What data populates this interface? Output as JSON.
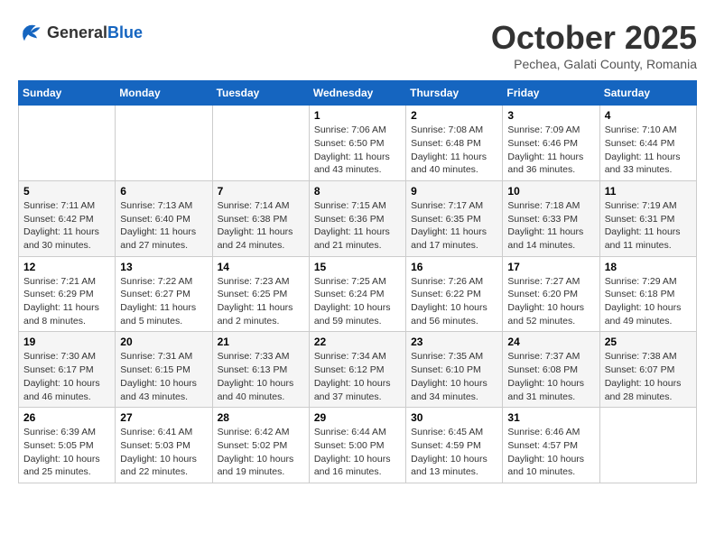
{
  "header": {
    "logo_general": "General",
    "logo_blue": "Blue",
    "month_title": "October 2025",
    "subtitle": "Pechea, Galati County, Romania"
  },
  "weekdays": [
    "Sunday",
    "Monday",
    "Tuesday",
    "Wednesday",
    "Thursday",
    "Friday",
    "Saturday"
  ],
  "weeks": [
    [
      {
        "day": "",
        "info": ""
      },
      {
        "day": "",
        "info": ""
      },
      {
        "day": "",
        "info": ""
      },
      {
        "day": "1",
        "info": "Sunrise: 7:06 AM\nSunset: 6:50 PM\nDaylight: 11 hours and 43 minutes."
      },
      {
        "day": "2",
        "info": "Sunrise: 7:08 AM\nSunset: 6:48 PM\nDaylight: 11 hours and 40 minutes."
      },
      {
        "day": "3",
        "info": "Sunrise: 7:09 AM\nSunset: 6:46 PM\nDaylight: 11 hours and 36 minutes."
      },
      {
        "day": "4",
        "info": "Sunrise: 7:10 AM\nSunset: 6:44 PM\nDaylight: 11 hours and 33 minutes."
      }
    ],
    [
      {
        "day": "5",
        "info": "Sunrise: 7:11 AM\nSunset: 6:42 PM\nDaylight: 11 hours and 30 minutes."
      },
      {
        "day": "6",
        "info": "Sunrise: 7:13 AM\nSunset: 6:40 PM\nDaylight: 11 hours and 27 minutes."
      },
      {
        "day": "7",
        "info": "Sunrise: 7:14 AM\nSunset: 6:38 PM\nDaylight: 11 hours and 24 minutes."
      },
      {
        "day": "8",
        "info": "Sunrise: 7:15 AM\nSunset: 6:36 PM\nDaylight: 11 hours and 21 minutes."
      },
      {
        "day": "9",
        "info": "Sunrise: 7:17 AM\nSunset: 6:35 PM\nDaylight: 11 hours and 17 minutes."
      },
      {
        "day": "10",
        "info": "Sunrise: 7:18 AM\nSunset: 6:33 PM\nDaylight: 11 hours and 14 minutes."
      },
      {
        "day": "11",
        "info": "Sunrise: 7:19 AM\nSunset: 6:31 PM\nDaylight: 11 hours and 11 minutes."
      }
    ],
    [
      {
        "day": "12",
        "info": "Sunrise: 7:21 AM\nSunset: 6:29 PM\nDaylight: 11 hours and 8 minutes."
      },
      {
        "day": "13",
        "info": "Sunrise: 7:22 AM\nSunset: 6:27 PM\nDaylight: 11 hours and 5 minutes."
      },
      {
        "day": "14",
        "info": "Sunrise: 7:23 AM\nSunset: 6:25 PM\nDaylight: 11 hours and 2 minutes."
      },
      {
        "day": "15",
        "info": "Sunrise: 7:25 AM\nSunset: 6:24 PM\nDaylight: 10 hours and 59 minutes."
      },
      {
        "day": "16",
        "info": "Sunrise: 7:26 AM\nSunset: 6:22 PM\nDaylight: 10 hours and 56 minutes."
      },
      {
        "day": "17",
        "info": "Sunrise: 7:27 AM\nSunset: 6:20 PM\nDaylight: 10 hours and 52 minutes."
      },
      {
        "day": "18",
        "info": "Sunrise: 7:29 AM\nSunset: 6:18 PM\nDaylight: 10 hours and 49 minutes."
      }
    ],
    [
      {
        "day": "19",
        "info": "Sunrise: 7:30 AM\nSunset: 6:17 PM\nDaylight: 10 hours and 46 minutes."
      },
      {
        "day": "20",
        "info": "Sunrise: 7:31 AM\nSunset: 6:15 PM\nDaylight: 10 hours and 43 minutes."
      },
      {
        "day": "21",
        "info": "Sunrise: 7:33 AM\nSunset: 6:13 PM\nDaylight: 10 hours and 40 minutes."
      },
      {
        "day": "22",
        "info": "Sunrise: 7:34 AM\nSunset: 6:12 PM\nDaylight: 10 hours and 37 minutes."
      },
      {
        "day": "23",
        "info": "Sunrise: 7:35 AM\nSunset: 6:10 PM\nDaylight: 10 hours and 34 minutes."
      },
      {
        "day": "24",
        "info": "Sunrise: 7:37 AM\nSunset: 6:08 PM\nDaylight: 10 hours and 31 minutes."
      },
      {
        "day": "25",
        "info": "Sunrise: 7:38 AM\nSunset: 6:07 PM\nDaylight: 10 hours and 28 minutes."
      }
    ],
    [
      {
        "day": "26",
        "info": "Sunrise: 6:39 AM\nSunset: 5:05 PM\nDaylight: 10 hours and 25 minutes."
      },
      {
        "day": "27",
        "info": "Sunrise: 6:41 AM\nSunset: 5:03 PM\nDaylight: 10 hours and 22 minutes."
      },
      {
        "day": "28",
        "info": "Sunrise: 6:42 AM\nSunset: 5:02 PM\nDaylight: 10 hours and 19 minutes."
      },
      {
        "day": "29",
        "info": "Sunrise: 6:44 AM\nSunset: 5:00 PM\nDaylight: 10 hours and 16 minutes."
      },
      {
        "day": "30",
        "info": "Sunrise: 6:45 AM\nSunset: 4:59 PM\nDaylight: 10 hours and 13 minutes."
      },
      {
        "day": "31",
        "info": "Sunrise: 6:46 AM\nSunset: 4:57 PM\nDaylight: 10 hours and 10 minutes."
      },
      {
        "day": "",
        "info": ""
      }
    ]
  ]
}
